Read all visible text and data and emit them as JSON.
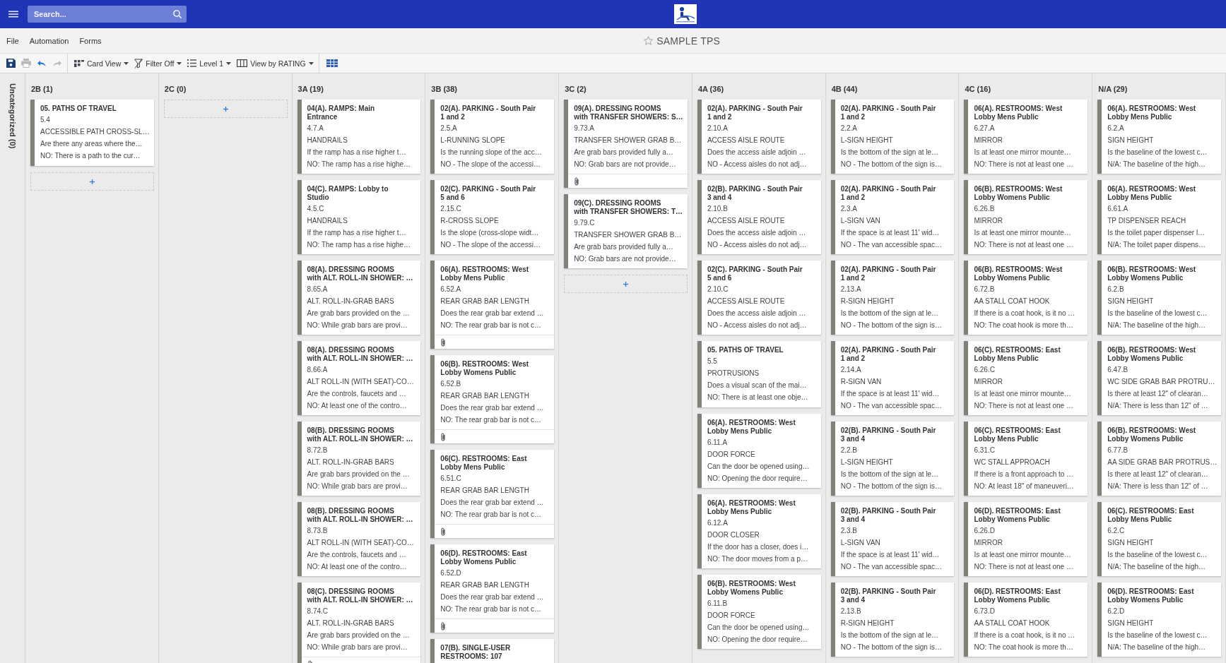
{
  "topbar": {
    "search": {
      "placeholder": "Search..."
    }
  },
  "menu": [
    "File",
    "Automation",
    "Forms"
  ],
  "title": {
    "text": "SAMPLE TPS",
    "starred": false
  },
  "toolbar": {
    "actions": [
      {
        "disabled": false
      },
      {
        "disabled": true
      },
      {
        "disabled": false
      },
      {
        "disabled": true
      }
    ],
    "dropdowns": [
      {
        "label": "Card View"
      },
      {
        "label": "Filter Off"
      },
      {
        "label": "Level 1"
      },
      {
        "label": "View by RATING"
      }
    ]
  },
  "board": {
    "collapsed_lane": "Uncategorized (0)",
    "columns": [
      {
        "title": "2B (1)",
        "add_slot": true,
        "cards": [
          {
            "title": "05. PATHS OF TRAVEL",
            "code": "5.4",
            "item": "ACCESSIBLE PATH CROSS-SL…",
            "question": "Are there any areas where the…",
            "answer": "NO: There is a path to the cur…",
            "attachment": false
          }
        ]
      },
      {
        "title": "2C (0)",
        "add_slot": true
      },
      {
        "title": "3A (19)",
        "add_slot": false,
        "cards": [
          {
            "title": "04(A). RAMPS: Main\nEntrance",
            "code": "4.7.A",
            "item": "HANDRAILS",
            "question": "If the ramp has a rise higher t…",
            "answer": "NO: The ramp has a rise highe…",
            "attachment": false
          },
          {
            "title": "04(C). RAMPS: Lobby to\nStudio",
            "code": "4.5.C",
            "item": "HANDRAILS",
            "question": "If the ramp has a rise higher t…",
            "answer": "NO: The ramp has a rise highe…",
            "attachment": false
          },
          {
            "title": "08(A). DRESSING ROOMS\nwith ALT. ROLL-IN SHOWER: …",
            "code": "8.65.A",
            "item": "ALT. ROLL-IN-GRAB BARS",
            "question": "Are grab bars provided on the …",
            "answer": "NO: While grab bars are provi…",
            "attachment": false
          },
          {
            "title": "08(A). DRESSING ROOMS\nwith ALT. ROLL-IN SHOWER: …",
            "code": "8.66.A",
            "item": "ALT ROLL-IN (WITH SEAT)-CO…",
            "question": "Are the controls, faucets and …",
            "answer": "NO: At least one of the contro…",
            "attachment": false
          },
          {
            "title": "08(B). DRESSING ROOMS\nwith ALT. ROLL-IN SHOWER: …",
            "code": "8.72.B",
            "item": "ALT. ROLL-IN-GRAB BARS",
            "question": "Are grab bars provided on the …",
            "answer": "NO: While grab bars are provi…",
            "attachment": false
          },
          {
            "title": "08(B). DRESSING ROOMS\nwith ALT. ROLL-IN SHOWER: …",
            "code": "8.73.B",
            "item": "ALT ROLL-IN (WITH SEAT)-CO…",
            "question": "Are the controls, faucets and …",
            "answer": "NO: At least one of the contro…",
            "attachment": false
          },
          {
            "title": "08(C). DRESSING ROOMS\nwith ALT. ROLL-IN SHOWER: …",
            "code": "8.74.C",
            "item": "ALT. ROLL-IN-GRAB BARS",
            "question": "Are grab bars provided on the …",
            "answer": "NO: While grab bars are provi…",
            "attachment": true
          }
        ]
      },
      {
        "title": "3B (38)",
        "add_slot": false,
        "cards": [
          {
            "title": "02(A). PARKING - South Pair\n1 and 2",
            "code": "2.5.A",
            "item": "L-RUNNING SLOPE",
            "question": "Is the running slope of the acc…",
            "answer": "NO - The slope of the accessi…",
            "attachment": false
          },
          {
            "title": "02(C). PARKING - South Pair\n5 and 6",
            "code": "2.15.C",
            "item": "R-CROSS SLOPE",
            "question": "Is the slope (cross-slope widt…",
            "answer": "NO - The slope of the accessi…",
            "attachment": false
          },
          {
            "title": "06(A). RESTROOMS: West\nLobby Mens Public",
            "code": "6.52.A",
            "item": "REAR GRAB BAR LENGTH",
            "question": "Does the rear grab bar extend …",
            "answer": "NO: The rear grab bar is not c…",
            "attachment": true
          },
          {
            "title": "06(B). RESTROOMS: West\nLobby Womens Public",
            "code": "6.52.B",
            "item": "REAR GRAB BAR LENGTH",
            "question": "Does the rear grab bar extend …",
            "answer": "NO: The rear grab bar is not c…",
            "attachment": true
          },
          {
            "title": "06(C). RESTROOMS: East\nLobby Mens Public",
            "code": "6.51.C",
            "item": "REAR GRAB BAR LENGTH",
            "question": "Does the rear grab bar extend …",
            "answer": "NO: The rear grab bar is not c…",
            "attachment": true
          },
          {
            "title": "06(D). RESTROOMS: East\nLobby Womens Public",
            "code": "6.52.D",
            "item": "REAR GRAB BAR LENGTH",
            "question": "Does the rear grab bar extend …",
            "answer": "NO: The rear grab bar is not c…",
            "attachment": true
          },
          {
            "title": "07(B). SINGLE-USER\nRESTROOMS: 107",
            "attachment": false
          }
        ]
      },
      {
        "title": "3C (2)",
        "add_slot": true,
        "cards": [
          {
            "title": "09(A). DRESSING ROOMS\nwith TRANSFER SHOWERS: S…",
            "code": "9.73.A",
            "item": "TRANSFER SHOWER GRAB B…",
            "question": "Are grab bars provided fully a…",
            "answer": "NO: Grab bars are not provide…",
            "attachment": true
          },
          {
            "title": "09(C). DRESSING ROOMS\nwith TRANSFER SHOWERS: T…",
            "code": "9.79.C",
            "item": "TRANSFER SHOWER GRAB B…",
            "question": "Are grab bars provided fully a…",
            "answer": "NO: Grab bars are not provide…",
            "attachment": false
          }
        ]
      },
      {
        "title": "4A (36)",
        "add_slot": false,
        "cards": [
          {
            "title": "02(A). PARKING - South Pair\n1 and 2",
            "code": "2.10.A",
            "item": "ACCESS AISLE ROUTE",
            "question": "Does the access aisle adjoin …",
            "answer": "NO - Access aisles do not adj…",
            "attachment": false
          },
          {
            "title": "02(B). PARKING - South Pair\n3 and 4",
            "code": "2.10.B",
            "item": "ACCESS AISLE ROUTE",
            "question": "Does the access aisle adjoin …",
            "answer": "NO - Access aisles do not adj…",
            "attachment": false
          },
          {
            "title": "02(C). PARKING - South Pair\n5 and 6",
            "code": "2.10.C",
            "item": "ACCESS AISLE ROUTE",
            "question": "Does the access aisle adjoin …",
            "answer": "NO - Access aisles do not adj…",
            "attachment": false
          },
          {
            "title": "05. PATHS OF TRAVEL",
            "code": "5.5",
            "item": "PROTRUSIONS",
            "question": "Does a visual scan of the mai…",
            "answer": "NO: There is at least one obje…",
            "attachment": false
          },
          {
            "title": "06(A). RESTROOMS: West\nLobby Mens Public",
            "code": "6.11.A",
            "item": "DOOR FORCE",
            "question": "Can the door be opened using…",
            "answer": "NO: Opening the door require…",
            "attachment": false
          },
          {
            "title": "06(A). RESTROOMS: West\nLobby Mens Public",
            "code": "6.12.A",
            "item": "DOOR CLOSER",
            "question": "If the door has a closer, does i…",
            "answer": "NO: The door moves from a p…",
            "attachment": false
          },
          {
            "title": "06(B). RESTROOMS: West\nLobby Womens Public",
            "code": "6.11.B",
            "item": "DOOR FORCE",
            "question": "Can the door be opened using…",
            "answer": "NO: Opening the door require…",
            "attachment": false
          }
        ]
      },
      {
        "title": "4B (44)",
        "add_slot": false,
        "cards": [
          {
            "title": "02(A). PARKING - South Pair\n1 and 2",
            "code": "2.2.A",
            "item": "L-SIGN HEIGHT",
            "question": "Is the bottom of the sign at le…",
            "answer": "NO - The bottom of the sign is…",
            "attachment": false
          },
          {
            "title": "02(A). PARKING - South Pair\n1 and 2",
            "code": "2.3.A",
            "item": "L-SIGN VAN",
            "question": "If the space is at least 11' wid…",
            "answer": "NO - The van accessible spac…",
            "attachment": false
          },
          {
            "title": "02(A). PARKING - South Pair\n1 and 2",
            "code": "2.13.A",
            "item": "R-SIGN HEIGHT",
            "question": "Is the bottom of the sign at le…",
            "answer": "NO - The bottom of the sign is…",
            "attachment": false
          },
          {
            "title": "02(A). PARKING - South Pair\n1 and 2",
            "code": "2.14.A",
            "item": "R-SIGN VAN",
            "question": "If the space is at least 11' wid…",
            "answer": "NO - The van accessible spac…",
            "attachment": false
          },
          {
            "title": "02(B). PARKING - South Pair\n3 and 4",
            "code": "2.2.B",
            "item": "L-SIGN HEIGHT",
            "question": "Is the bottom of the sign at le…",
            "answer": "NO - The bottom of the sign is…",
            "attachment": false
          },
          {
            "title": "02(B). PARKING - South Pair\n3 and 4",
            "code": "2.3.B",
            "item": "L-SIGN VAN",
            "question": "If the space is at least 11' wid…",
            "answer": "NO - The van accessible spac…",
            "attachment": false
          },
          {
            "title": "02(B). PARKING - South Pair\n3 and 4",
            "code": "2.13.B",
            "item": "R-SIGN HEIGHT",
            "question": "Is the bottom of the sign at le…",
            "answer": "NO - The bottom of the sign is…",
            "attachment": false
          }
        ]
      },
      {
        "title": "4C (16)",
        "add_slot": false,
        "cards": [
          {
            "title": "06(A). RESTROOMS: West\nLobby Mens Public",
            "code": "6.27.A",
            "item": "MIRROR",
            "question": "Is at least one mirror mounte…",
            "answer": "NO: There is not at least one …",
            "attachment": false
          },
          {
            "title": "06(B). RESTROOMS: West\nLobby Womens Public",
            "code": "6.26.B",
            "item": "MIRROR",
            "question": "Is at least one mirror mounte…",
            "answer": "NO: There is not at least one …",
            "attachment": false
          },
          {
            "title": "06(B). RESTROOMS: West\nLobby Womens Public",
            "code": "6.72.B",
            "item": "AA STALL COAT HOOK",
            "question": "If there is a coat hook, is it no …",
            "answer": "NO: The coat hook is more th…",
            "attachment": false
          },
          {
            "title": "06(C). RESTROOMS: East\nLobby Mens Public",
            "code": "6.26.C",
            "item": "MIRROR",
            "question": "Is at least one mirror mounte…",
            "answer": "NO: There is not at least one …",
            "attachment": false
          },
          {
            "title": "06(C). RESTROOMS: East\nLobby Mens Public",
            "code": "6.31.C",
            "item": "WC STALL APPROACH",
            "question": "If there is a front approach to …",
            "answer": "NO: At least 18\" of maneuveri…",
            "attachment": false
          },
          {
            "title": "06(D). RESTROOMS: East\nLobby Womens Public",
            "code": "6.26.D",
            "item": "MIRROR",
            "question": "Is at least one mirror mounte…",
            "answer": "NO: There is not at least one …",
            "attachment": false
          },
          {
            "title": "06(D). RESTROOMS: East\nLobby Womens Public",
            "code": "6.73.D",
            "item": "AA STALL COAT HOOK",
            "question": "If there is a coat hook, is it no …",
            "answer": "NO: The coat hook is more th…",
            "attachment": false
          }
        ]
      },
      {
        "title": "N/A (29)",
        "add_slot": false,
        "cards": [
          {
            "title": "06(A). RESTROOMS: West\nLobby Mens Public",
            "code": "6.2.A",
            "item": "SIGN HEIGHT",
            "question": "Is the baseline of the lowest c…",
            "answer": "N/A: The baseline of the high…",
            "attachment": false
          },
          {
            "title": "06(A). RESTROOMS: West\nLobby Mens Public",
            "code": "6.61.A",
            "item": "TP DISPENSER REACH",
            "question": "Is the toilet paper dispenser l…",
            "answer": "N/A: The toilet paper dispens…",
            "attachment": false
          },
          {
            "title": "06(B). RESTROOMS: West\nLobby Womens Public",
            "code": "6.2.B",
            "item": "SIGN HEIGHT",
            "question": "Is the baseline of the lowest c…",
            "answer": "N/A: The baseline of the high…",
            "attachment": false
          },
          {
            "title": "06(B). RESTROOMS: West\nLobby Womens Public",
            "code": "6.47.B",
            "item": "WC SIDE GRAB BAR PROTRU…",
            "question": "Is there at least 12\" of clearan…",
            "answer": "N/A: There is less than 12\" of …",
            "attachment": false
          },
          {
            "title": "06(B). RESTROOMS: West\nLobby Womens Public",
            "code": "6.77.B",
            "item": "AA SIDE GRAB BAR PROTRUS…",
            "question": "Is there at least 12\" of clearan…",
            "answer": "N/A: There is less than 12\" of …",
            "attachment": false
          },
          {
            "title": "06(C). RESTROOMS: East\nLobby Mens Public",
            "code": "6.2.C",
            "item": "SIGN HEIGHT",
            "question": "Is the baseline of the lowest c…",
            "answer": "N/A: The baseline of the high…",
            "attachment": false
          },
          {
            "title": "06(D). RESTROOMS: East\nLobby Womens Public",
            "code": "6.2.D",
            "item": "SIGN HEIGHT",
            "question": "Is the baseline of the lowest c…",
            "answer": "N/A: The baseline of the high…",
            "attachment": false
          }
        ]
      }
    ]
  }
}
